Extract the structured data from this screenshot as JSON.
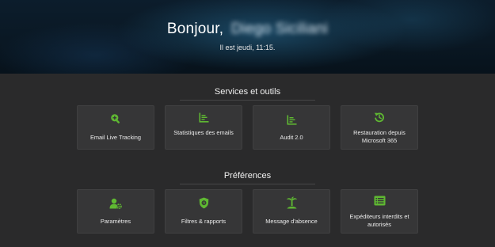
{
  "hero": {
    "greeting": "Bonjour,",
    "user_name": "Diego Siciliani",
    "date_text": "Il est jeudi, 11:15."
  },
  "services": {
    "title": "Services et outils",
    "items": [
      {
        "label": "Email Live Tracking",
        "icon": "search-plus-icon"
      },
      {
        "label": "Statistiques des emails",
        "icon": "bar-chart-icon"
      },
      {
        "label": "Audit 2.0",
        "icon": "bar-chart-icon"
      },
      {
        "label": "Restauration depuis Microsoft 365",
        "icon": "restore-icon"
      }
    ]
  },
  "preferences": {
    "title": "Préférences",
    "items": [
      {
        "label": "Paramètres",
        "icon": "user-settings-icon"
      },
      {
        "label": "Filtres & rapports",
        "icon": "shield-icon"
      },
      {
        "label": "Message d'absence",
        "icon": "palm-tree-icon"
      },
      {
        "label": "Expéditeurs interdits et autorisés",
        "icon": "list-icon"
      }
    ]
  },
  "colors": {
    "accent": "#5fb832",
    "background": "#2a2a2b",
    "card": "#363637"
  }
}
